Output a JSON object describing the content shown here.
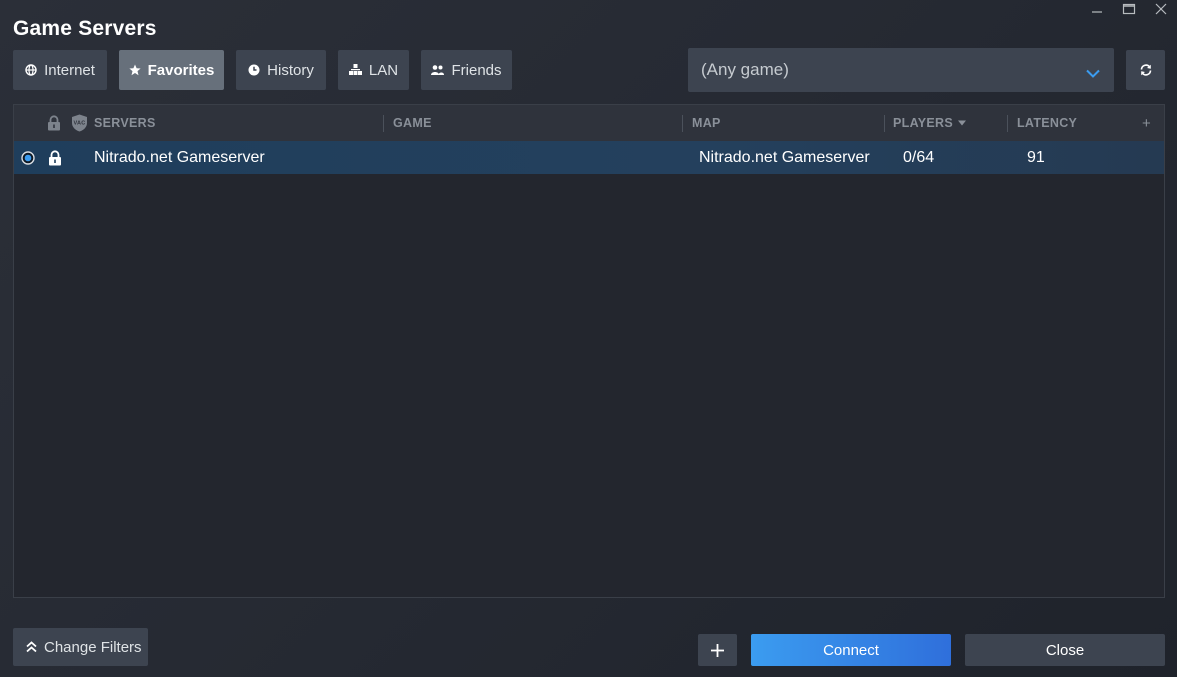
{
  "window": {
    "title": "Game Servers"
  },
  "tabs": [
    {
      "label": "Internet",
      "icon": "globe-icon",
      "active": false
    },
    {
      "label": "Favorites",
      "icon": "star-icon",
      "active": true
    },
    {
      "label": "History",
      "icon": "clock-icon",
      "active": false
    },
    {
      "label": "LAN",
      "icon": "lan-icon",
      "active": false
    },
    {
      "label": "Friends",
      "icon": "friends-icon",
      "active": false
    }
  ],
  "game_filter": {
    "value": "(Any game)"
  },
  "table": {
    "columns": {
      "servers": "SERVERS",
      "game": "GAME",
      "map": "MAP",
      "players": "PLAYERS",
      "latency": "LATENCY",
      "vac_badge": "VAC",
      "add_column": "+"
    },
    "rows": [
      {
        "name": "Nitrado.net Gameserver",
        "game": "",
        "map": "Nitrado.net Gameserver",
        "players": "0/64",
        "latency": "91",
        "selected": true,
        "locked": true
      }
    ]
  },
  "footer": {
    "change_filters_label": "Change Filters",
    "add_label": "+",
    "connect_label": "Connect",
    "close_label": "Close"
  },
  "colors": {
    "accent_blue": "#3b9cf0",
    "selected_row": "#1f3e5c",
    "active_tab": "#67707b"
  }
}
